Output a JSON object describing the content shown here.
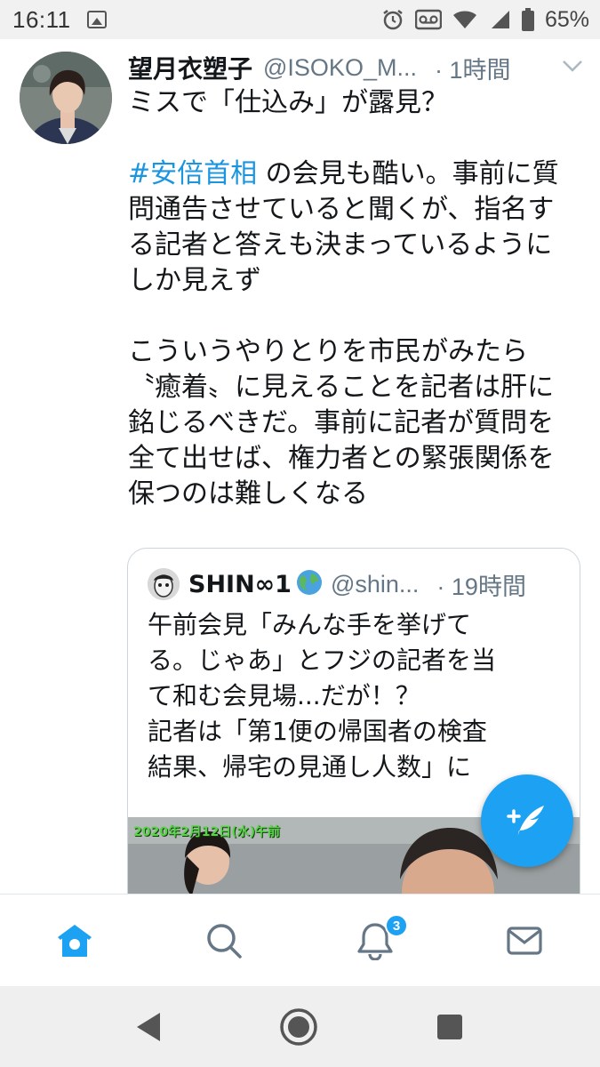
{
  "status_bar": {
    "time": "16:11",
    "battery_percent": "65%",
    "icons": [
      "image-icon",
      "alarm-icon",
      "voicemail-icon",
      "wifi-icon",
      "signal-icon",
      "battery-icon"
    ]
  },
  "tweet": {
    "author_name": "望月衣塑子",
    "author_handle": "@ISOKO_M...",
    "time": "· 1時間",
    "lines": {
      "l1": "ミスで「仕込み」が露見？",
      "l2_hashtag": "#安倍首相",
      "l2_rest": " の会見も酷い。事前に質",
      "l3": "問通告させていると聞くが、指名す",
      "l4": "る記者と答えも決まっているように",
      "l5": "しか見えず",
      "l6": "こういうやりとりを市民がみたら",
      "l7": "〝癒着〟に見えることを記者は肝に",
      "l8": "銘じるべきだ。事前に記者が質問を",
      "l9": "全て出せば、権力者との緊張関係を",
      "l10": "保つのは難しくなる"
    }
  },
  "quoted_tweet": {
    "author_name": "SHIN∞1",
    "author_handle": "@shin...",
    "time": "· 19時間",
    "lines": {
      "l1": "午前会見「みんな手を挙げて",
      "l2": "る。じゃあ」とフジの記者を当",
      "l3": "て和む会見場...だが！？",
      "l4": "記者は「第1便の帰国者の検査",
      "l5": "結果、帰宅の見通し人数」に"
    },
    "media_caption": "2020年2月12日(水)午前"
  },
  "tab_bar": {
    "tabs": [
      "home-icon",
      "search-icon",
      "notifications-icon",
      "messages-icon"
    ],
    "notification_count": "3",
    "active_color": "#1da1f2"
  },
  "colors": {
    "accent": "#1da1f2",
    "hashtag": "#1b95e0",
    "secondary_text": "#657786"
  }
}
